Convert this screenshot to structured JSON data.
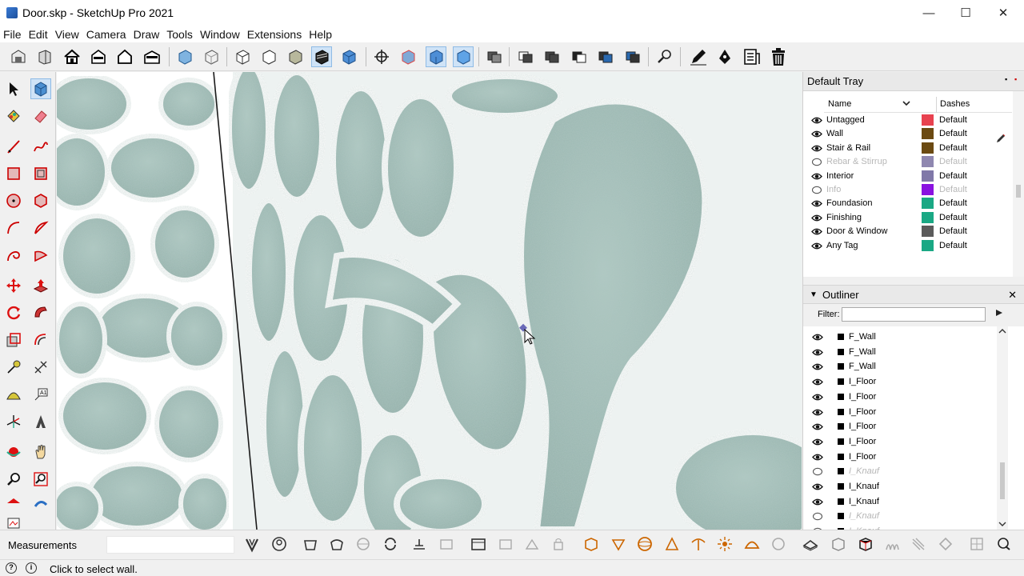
{
  "window": {
    "title": "Door.skp - SketchUp Pro 2021",
    "minimize": "—",
    "maximize": "☐",
    "close": "✕"
  },
  "menu": [
    "File",
    "Edit",
    "View",
    "Camera",
    "Draw",
    "Tools",
    "Window",
    "Extensions",
    "Help"
  ],
  "toolbar_icons": [
    "warehouse-icon",
    "component-icon",
    "home-view-icon",
    "front-view-icon",
    "house-outline-icon",
    "back-view-icon",
    "xray-icon",
    "wireframe-icon",
    "hidden-line-icon",
    "shaded-icon",
    "shaded-textures-icon",
    "monochrome-icon",
    "section-plane-icon",
    "section-display-icon",
    "section-cut-icon",
    "section-fill-icon",
    "solid-tools-icon",
    "outer-shell-icon",
    "intersect-icon",
    "union-icon",
    "subtract-icon",
    "trim-icon",
    "split-icon",
    "search-icon",
    "pencil-icon",
    "pen-icon",
    "report-icon",
    "trash-icon"
  ],
  "left_tools": [
    "select-icon",
    "make-component-icon",
    "paint-bucket-icon",
    "eraser-icon",
    "line-icon",
    "freehand-icon",
    "rectangle-icon",
    "rotated-rectangle-icon",
    "circle-icon",
    "polygon-icon",
    "arc-icon",
    "two-point-arc-icon",
    "three-point-arc-icon",
    "pie-icon",
    "move-icon",
    "push-pull-icon",
    "rotate-icon",
    "follow-me-icon",
    "scale-icon",
    "offset-icon",
    "tape-measure-icon",
    "dimension-icon",
    "protractor-icon",
    "text-icon",
    "axes-icon",
    "3d-text-icon",
    "orbit-icon",
    "pan-icon",
    "zoom-icon",
    "zoom-window-icon",
    "zoom-extents-icon",
    "previous-view-icon"
  ],
  "tray": {
    "title": "Default Tray",
    "tags": {
      "col_name": "Name",
      "col_dashes": "Dashes",
      "rows": [
        {
          "name": "Untagged",
          "color": "#e8424f",
          "dashes": "Default",
          "visible": true
        },
        {
          "name": "Wall",
          "color": "#6b4a12",
          "dashes": "Default",
          "visible": true
        },
        {
          "name": "Stair & Rail",
          "color": "#6b4a12",
          "dashes": "Default",
          "visible": true
        },
        {
          "name": "Rebar & Stirrup",
          "color": "#8f87b0",
          "dashes": "Default",
          "visible": false
        },
        {
          "name": "Interior",
          "color": "#8078a8",
          "dashes": "Default",
          "visible": true
        },
        {
          "name": "Info",
          "color": "#8a12e0",
          "dashes": "Default",
          "visible": false
        },
        {
          "name": "Foundasion",
          "color": "#1aa884",
          "dashes": "Default",
          "visible": true
        },
        {
          "name": "Finishing",
          "color": "#1aa884",
          "dashes": "Default",
          "visible": true
        },
        {
          "name": "Door & Window",
          "color": "#5b5b5b",
          "dashes": "Default",
          "visible": true
        },
        {
          "name": "Any Tag",
          "color": "#1aa884",
          "dashes": "Default",
          "visible": true
        }
      ]
    },
    "outliner": {
      "title": "Outliner",
      "filter_label": "Filter:",
      "filter_value": "",
      "rows": [
        {
          "name": "F_Wall",
          "visible": true
        },
        {
          "name": "F_Wall",
          "visible": true
        },
        {
          "name": "F_Wall",
          "visible": true
        },
        {
          "name": "I_Floor",
          "visible": true
        },
        {
          "name": "I_Floor",
          "visible": true
        },
        {
          "name": "I_Floor",
          "visible": true
        },
        {
          "name": "I_Floor",
          "visible": true
        },
        {
          "name": "I_Floor",
          "visible": true
        },
        {
          "name": "I_Floor",
          "visible": true
        },
        {
          "name": "I_Knauf",
          "visible": false
        },
        {
          "name": "I_Knauf",
          "visible": true
        },
        {
          "name": "I_Knauf",
          "visible": true
        },
        {
          "name": "I_Knauf",
          "visible": false
        },
        {
          "name": "I_Knauf",
          "visible": false
        }
      ]
    }
  },
  "bottom": {
    "measurements_label": "Measurements",
    "measurements_value": "",
    "icons": [
      "sandbox-from-contours-icon",
      "sandbox-from-scratch-icon",
      "smoove-icon",
      "stamp-icon",
      "drape-icon",
      "add-detail-icon",
      "flip-edge-icon",
      "dimension-style-icon",
      "label-icon",
      "scene-icon",
      "photo-match-icon",
      "camera-icon",
      "lock-icon",
      "geo-location-icon",
      "soften-icon",
      "sphere-icon",
      "cone-icon",
      "umbrella-icon",
      "sun-icon",
      "dome-icon",
      "cube-icon",
      "layout-icon",
      "box-icon",
      "component-edit-icon",
      "hatch-icon",
      "tag-icon",
      "grid-icon",
      "extension-icon",
      "close-group-icon"
    ]
  },
  "status": {
    "text": "Click to select wall."
  }
}
